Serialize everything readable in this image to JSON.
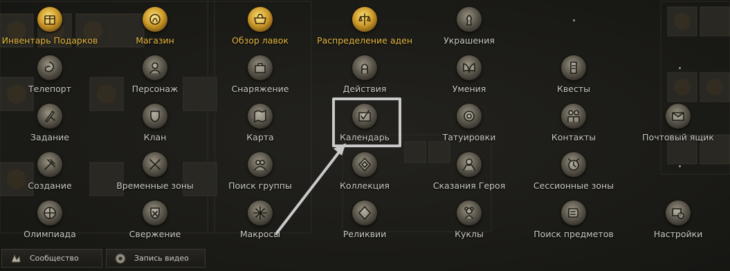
{
  "colors": {
    "label": "#c9c8c3",
    "label_highlight": "#e8b940",
    "background": "#1c1c19",
    "highlight_box": "#c9c9c9"
  },
  "menu": [
    {
      "label": "Инвентарь Подарков",
      "icon": "gift-inventory-icon",
      "gold": true
    },
    {
      "label": "Магазин",
      "icon": "shop-icon",
      "gold": true
    },
    {
      "label": "Обзор лавок",
      "icon": "stalls-overview-icon",
      "gold": true
    },
    {
      "label": "Распределение аден",
      "icon": "adena-distribution-icon",
      "gold": true
    },
    {
      "label": "Украшения",
      "icon": "decoration-icon",
      "gold": false
    },
    {
      "label": "Телепорт",
      "icon": "teleport-icon",
      "gold": false
    },
    {
      "label": "Персонаж",
      "icon": "character-icon",
      "gold": false
    },
    {
      "label": "Снаряжение",
      "icon": "equipment-icon",
      "gold": false
    },
    {
      "label": "Действия",
      "icon": "actions-icon",
      "gold": false
    },
    {
      "label": "Умения",
      "icon": "skills-icon",
      "gold": false
    },
    {
      "label": "Квесты",
      "icon": "quests-icon",
      "gold": false
    },
    {
      "label": "Задание",
      "icon": "task-icon",
      "gold": false
    },
    {
      "label": "Клан",
      "icon": "clan-icon",
      "gold": false
    },
    {
      "label": "Карта",
      "icon": "map-icon",
      "gold": false
    },
    {
      "label": "Календарь",
      "icon": "calendar-icon",
      "gold": false
    },
    {
      "label": "Татуировки",
      "icon": "tattoo-icon",
      "gold": false
    },
    {
      "label": "Контакты",
      "icon": "contacts-icon",
      "gold": false
    },
    {
      "label": "Почтовый ящик",
      "icon": "mailbox-icon",
      "gold": false
    },
    {
      "label": "Создание",
      "icon": "crafting-icon",
      "gold": false
    },
    {
      "label": "Временные зоны",
      "icon": "time-zones-icon",
      "gold": false
    },
    {
      "label": "Поиск группы",
      "icon": "party-search-icon",
      "gold": false
    },
    {
      "label": "Коллекция",
      "icon": "collection-icon",
      "gold": false
    },
    {
      "label": "Сказания Героя",
      "icon": "hero-tales-icon",
      "gold": false
    },
    {
      "label": "Сессионные зоны",
      "icon": "session-zones-icon",
      "gold": false
    },
    {
      "label": "Олимпиада",
      "icon": "olympiad-icon",
      "gold": false
    },
    {
      "label": "Свержение",
      "icon": "overthrow-icon",
      "gold": false
    },
    {
      "label": "Макросы",
      "icon": "macros-icon",
      "gold": false
    },
    {
      "label": "Реликвии",
      "icon": "relics-icon",
      "gold": false
    },
    {
      "label": "Куклы",
      "icon": "dolls-icon",
      "gold": false
    },
    {
      "label": "Поиск предметов",
      "icon": "item-search-icon",
      "gold": false
    },
    {
      "label": "Настройки",
      "icon": "settings-icon",
      "gold": false
    }
  ],
  "bottom_bar": [
    {
      "label": "Сообщество",
      "icon": "community-icon"
    },
    {
      "label": "Запись видео",
      "icon": "video-record-icon"
    }
  ]
}
